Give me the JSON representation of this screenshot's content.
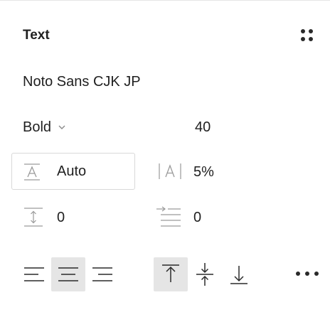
{
  "panel": {
    "title": "Text",
    "settings_icon": "four-dots-grid-icon"
  },
  "font": {
    "family": "Noto Sans CJK JP",
    "weight": "Bold",
    "weight_icon": "chevron-down-icon",
    "size": "40"
  },
  "spacing": {
    "line_height": "Auto",
    "line_height_icon": "line-height-icon",
    "letter_spacing": "5%",
    "letter_spacing_icon": "letter-spacing-icon",
    "paragraph_spacing": "0",
    "paragraph_spacing_icon": "paragraph-spacing-icon",
    "paragraph_indent": "0",
    "paragraph_indent_icon": "paragraph-indent-icon"
  },
  "alignment": {
    "horizontal": [
      {
        "name": "align-left",
        "icon": "align-left-icon",
        "active": false
      },
      {
        "name": "align-center",
        "icon": "align-center-icon",
        "active": true
      },
      {
        "name": "align-right",
        "icon": "align-right-icon",
        "active": false
      }
    ],
    "vertical": [
      {
        "name": "align-top",
        "icon": "align-top-icon",
        "active": true
      },
      {
        "name": "align-middle",
        "icon": "align-middle-icon",
        "active": false
      },
      {
        "name": "align-bottom",
        "icon": "align-bottom-icon",
        "active": false
      }
    ],
    "more_icon": "more-horizontal-icon"
  },
  "colors": {
    "text": "#1f1f1f",
    "icon_muted": "#9a9a9a",
    "active_bg": "#e5e5e5",
    "border": "#d9d9d9"
  }
}
